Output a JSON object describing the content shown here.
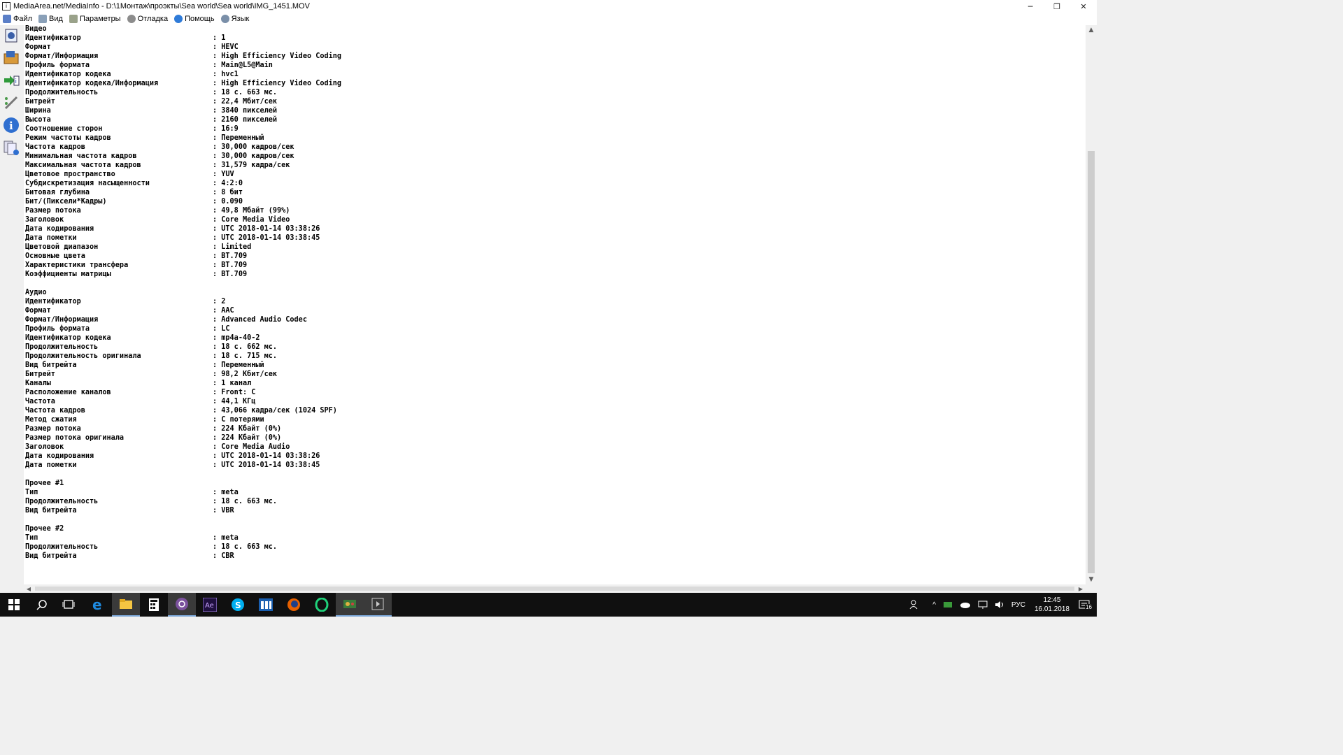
{
  "window": {
    "title": "MediaArea.net/MediaInfo - D:\\1Монтаж\\проэкты\\Sea world\\Sea world\\IMG_1451.MOV",
    "controls": {
      "minimize": "─",
      "restore": "❐",
      "close": "✕"
    }
  },
  "menu": [
    {
      "label": "Файл",
      "icon": "file-icon"
    },
    {
      "label": "Вид",
      "icon": "view-icon"
    },
    {
      "label": "Параметры",
      "icon": "options-icon"
    },
    {
      "label": "Отладка",
      "icon": "debug-icon"
    },
    {
      "label": "Помощь",
      "icon": "help-icon"
    },
    {
      "label": "Язык",
      "icon": "language-icon"
    }
  ],
  "toolbar": [
    "open-file-icon",
    "open-folder-icon",
    "export-icon",
    "settings-icon",
    "about-icon",
    "knowledge-icon"
  ],
  "report": {
    "sections": [
      {
        "title": "Видео",
        "fields": [
          {
            "k": "Идентификатор",
            "v": "1"
          },
          {
            "k": "Формат",
            "v": "HEVC"
          },
          {
            "k": "Формат/Информация",
            "v": "High Efficiency Video Coding"
          },
          {
            "k": "Профиль формата",
            "v": "Main@L5@Main"
          },
          {
            "k": "Идентификатор кодека",
            "v": "hvc1"
          },
          {
            "k": "Идентификатор кодека/Информация",
            "v": "High Efficiency Video Coding"
          },
          {
            "k": "Продолжительность",
            "v": "18 с. 663 мс."
          },
          {
            "k": "Битрейт",
            "v": "22,4 Мбит/сек"
          },
          {
            "k": "Ширина",
            "v": "3840 пикселей"
          },
          {
            "k": "Высота",
            "v": "2160 пикселей"
          },
          {
            "k": "Соотношение сторон",
            "v": "16:9"
          },
          {
            "k": "Режим частоты кадров",
            "v": "Переменный"
          },
          {
            "k": "Частота кадров",
            "v": "30,000 кадров/сек"
          },
          {
            "k": "Минимальная частота кадров",
            "v": "30,000 кадров/сек"
          },
          {
            "k": "Максимальная частота кадров",
            "v": "31,579 кадра/сек"
          },
          {
            "k": "Цветовое пространство",
            "v": "YUV"
          },
          {
            "k": "Субдискретизация насыщенности",
            "v": "4:2:0"
          },
          {
            "k": "Битовая глубина",
            "v": "8 бит"
          },
          {
            "k": "Бит/(Пиксели*Кадры)",
            "v": "0.090"
          },
          {
            "k": "Размер потока",
            "v": "49,8 Мбайт (99%)"
          },
          {
            "k": "Заголовок",
            "v": "Core Media Video"
          },
          {
            "k": "Дата кодирования",
            "v": "UTC 2018-01-14 03:38:26"
          },
          {
            "k": "Дата пометки",
            "v": "UTC 2018-01-14 03:38:45"
          },
          {
            "k": "Цветовой диапазон",
            "v": "Limited"
          },
          {
            "k": "Основные цвета",
            "v": "BT.709"
          },
          {
            "k": "Характеристики трансфера",
            "v": "BT.709"
          },
          {
            "k": "Коэффициенты матрицы",
            "v": "BT.709"
          }
        ]
      },
      {
        "title": "Аудио",
        "fields": [
          {
            "k": "Идентификатор",
            "v": "2"
          },
          {
            "k": "Формат",
            "v": "AAC"
          },
          {
            "k": "Формат/Информация",
            "v": "Advanced Audio Codec"
          },
          {
            "k": "Профиль формата",
            "v": "LC"
          },
          {
            "k": "Идентификатор кодека",
            "v": "mp4a-40-2"
          },
          {
            "k": "Продолжительность",
            "v": "18 с. 662 мс."
          },
          {
            "k": "Продолжительность оригинала",
            "v": "18 с. 715 мс."
          },
          {
            "k": "Вид битрейта",
            "v": "Переменный"
          },
          {
            "k": "Битрейт",
            "v": "98,2 Кбит/сек"
          },
          {
            "k": "Каналы",
            "v": "1 канал"
          },
          {
            "k": "Расположение каналов",
            "v": "Front: C"
          },
          {
            "k": "Частота",
            "v": "44,1 КГц"
          },
          {
            "k": "Частота кадров",
            "v": "43,066 кадра/сек (1024 SPF)"
          },
          {
            "k": "Метод сжатия",
            "v": "С потерями"
          },
          {
            "k": "Размер потока",
            "v": "224 Кбайт (0%)"
          },
          {
            "k": "Размер потока оригинала",
            "v": "224 Кбайт (0%)"
          },
          {
            "k": "Заголовок",
            "v": "Core Media Audio"
          },
          {
            "k": "Дата кодирования",
            "v": "UTC 2018-01-14 03:38:26"
          },
          {
            "k": "Дата пометки",
            "v": "UTC 2018-01-14 03:38:45"
          }
        ]
      },
      {
        "title": "Прочее #1",
        "fields": [
          {
            "k": "Тип",
            "v": "meta"
          },
          {
            "k": "Продолжительность",
            "v": "18 с. 663 мс."
          },
          {
            "k": "Вид битрейта",
            "v": "VBR"
          }
        ]
      },
      {
        "title": "Прочее #2",
        "fields": [
          {
            "k": "Тип",
            "v": "meta"
          },
          {
            "k": "Продолжительность",
            "v": "18 с. 663 мс."
          },
          {
            "k": "Вид битрейта",
            "v": "CBR"
          }
        ]
      }
    ]
  },
  "taskbar": {
    "apps": [
      "start-icon",
      "search-icon",
      "task-view-icon",
      "edge-icon",
      "explorer-icon",
      "calculator-icon",
      "viber-icon",
      "after-effects-icon",
      "skype-icon",
      "app-window-icon",
      "firefox-icon",
      "opera-icon",
      "game-icon",
      "mediainfo-icon"
    ],
    "tray": {
      "language": "РУС",
      "time": "12:45",
      "date": "16.01.2018",
      "notifications": "16"
    }
  }
}
